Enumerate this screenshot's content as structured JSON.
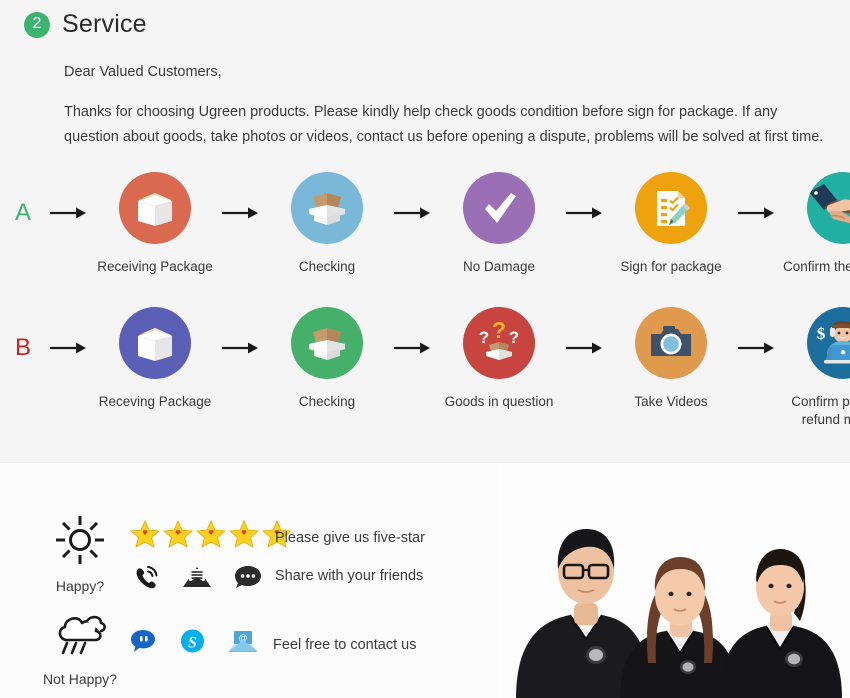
{
  "section": {
    "badge": "2",
    "title": "Service",
    "greeting": "Dear Valued Customers,",
    "intro": "Thanks for choosing Ugreen products. Please kindly help check goods condition before sign for package. If any question about goods, take photos or videos, contact us before opening a dispute, problems will be solved at first time."
  },
  "flows": [
    {
      "letter": "A",
      "letter_color": "#3cb46e",
      "steps": [
        {
          "label": "Receiving Package",
          "icon": "closed-box-icon",
          "color": "#d9694f"
        },
        {
          "label": "Checking",
          "icon": "open-box-icon",
          "color": "#7ab8d9"
        },
        {
          "label": "No Damage",
          "icon": "checkmark-icon",
          "color": "#9b6fb5"
        },
        {
          "label": "Sign for package",
          "icon": "signed-document-icon",
          "color": "#eda20e"
        },
        {
          "label": "Confirm the delivery",
          "icon": "handshake-icon",
          "color": "#22b0a3"
        }
      ]
    },
    {
      "letter": "B",
      "letter_color": "#cc2222",
      "steps": [
        {
          "label": "Receving Package",
          "icon": "closed-box-icon",
          "color": "#5b5fb5"
        },
        {
          "label": "Checking",
          "icon": "open-box-icon",
          "color": "#45b06a"
        },
        {
          "label": "Goods in question",
          "icon": "question-box-icon",
          "color": "#c8453f"
        },
        {
          "label": "Take Videos",
          "icon": "camera-icon",
          "color": "#e09a4e"
        },
        {
          "label": "Confirm problem, refund money",
          "icon": "support-agent-icon",
          "color": "#1c6f9c"
        }
      ]
    }
  ],
  "contact": {
    "happy_label": "Happy?",
    "not_happy_label": "Not Happy?",
    "happy_icon": "sun-icon",
    "not_happy_icon": "rain-cloud-icon",
    "star_count": 5,
    "star_color": "#ffd21e",
    "message_five_star": "Please give us five-star",
    "message_share": "Share with your friends",
    "message_contact": "Feel free to contact us",
    "social_icons": [
      "phone-ring-icon",
      "mail-open-icon",
      "chat-bubble-icon"
    ],
    "contact_icons": [
      "trademanager-icon",
      "skype-icon",
      "email-at-icon"
    ]
  }
}
